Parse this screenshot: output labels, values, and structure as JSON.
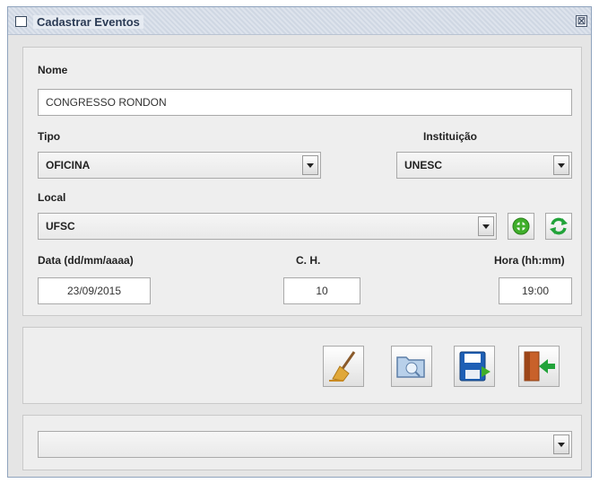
{
  "window": {
    "title": "Cadastrar Eventos",
    "close_glyph": "⊠"
  },
  "form": {
    "nome_label": "Nome",
    "nome_value": "CONGRESSO RONDON",
    "tipo_label": "Tipo",
    "tipo_value": "OFICINA",
    "instituicao_label": "Instituição",
    "instituicao_value": "UNESC",
    "local_label": "Local",
    "local_value": "UFSC",
    "data_label": "Data (dd/mm/aaaa)",
    "data_value": "23/09/2015",
    "ch_label": "C. H.",
    "ch_value": "10",
    "hora_label": "Hora (hh:mm)",
    "hora_value": "19:00"
  },
  "actions": {
    "icons": [
      "broom-icon",
      "folder-icon",
      "save-icon",
      "exit-door-icon"
    ]
  },
  "bottom": {
    "combo_value": ""
  },
  "colors": {
    "add_green": "#3fae2a",
    "refresh_green": "#22a33a",
    "save_blue": "#1e5fb5",
    "door_orange": "#c8612a"
  }
}
